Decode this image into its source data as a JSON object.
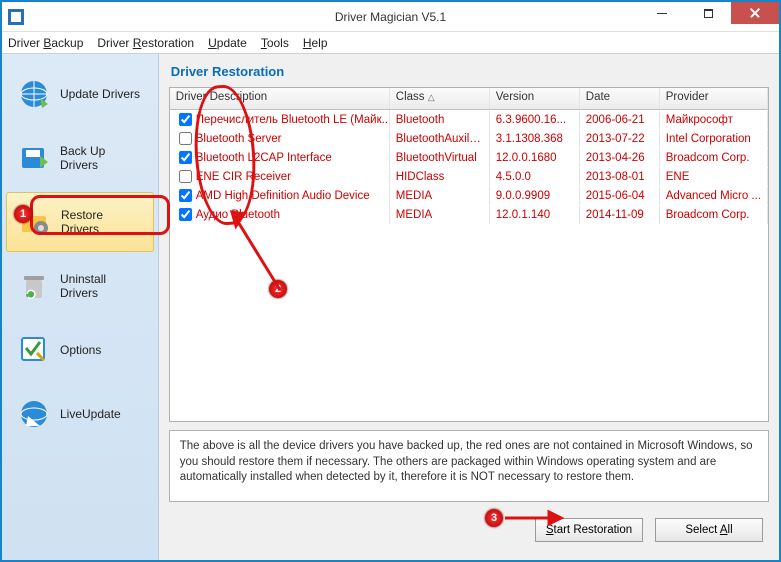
{
  "title": "Driver Magician V5.1",
  "menu": {
    "backup": "Driver Backup",
    "restoration": "Driver Restoration",
    "update": "Update",
    "tools": "Tools",
    "help": "Help"
  },
  "sidebar": {
    "items": [
      {
        "label": "Update Drivers"
      },
      {
        "label": "Back Up Drivers"
      },
      {
        "label": "Restore Drivers"
      },
      {
        "label": "Uninstall Drivers"
      },
      {
        "label": "Options"
      },
      {
        "label": "LiveUpdate"
      }
    ]
  },
  "panel": {
    "title": "Driver Restoration",
    "cols": {
      "desc": "Driver Description",
      "class": "Class",
      "version": "Version",
      "date": "Date",
      "provider": "Provider"
    },
    "rows": [
      {
        "checked": true,
        "red": true,
        "desc": "Перечислитель Bluetooth LE (Майк...",
        "class": "Bluetooth",
        "version": "6.3.9600.16...",
        "date": "2006-06-21",
        "provider": "Майкрософт"
      },
      {
        "checked": false,
        "red": true,
        "desc": "Bluetooth Server",
        "class": "BluetoothAuxiliary",
        "version": "3.1.1308.368",
        "date": "2013-07-22",
        "provider": "Intel Corporation"
      },
      {
        "checked": true,
        "red": true,
        "desc": "Bluetooth L2CAP Interface",
        "class": "BluetoothVirtual",
        "version": "12.0.0.1680",
        "date": "2013-04-26",
        "provider": "Broadcom Corp."
      },
      {
        "checked": false,
        "red": true,
        "desc": "ENE CIR Receiver",
        "class": "HIDClass",
        "version": "4.5.0.0",
        "date": "2013-08-01",
        "provider": "ENE"
      },
      {
        "checked": true,
        "red": true,
        "desc": "AMD High Definition Audio Device",
        "class": "MEDIA",
        "version": "9.0.0.9909",
        "date": "2015-06-04",
        "provider": "Advanced Micro ..."
      },
      {
        "checked": true,
        "red": true,
        "desc": "Аудио Bluetooth",
        "class": "MEDIA",
        "version": "12.0.1.140",
        "date": "2014-11-09",
        "provider": "Broadcom Corp."
      }
    ],
    "info": "The above is all the device drivers you have backed up, the red ones are not contained in Microsoft Windows, so you should restore them if necessary. The others are packaged within Windows operating system and are automatically installed when detected by it, therefore it is NOT necessary to restore them."
  },
  "footer": {
    "start": "Start Restoration",
    "select": "Select All"
  },
  "annotations": {
    "b1": "1",
    "b2": "2",
    "b3": "3"
  }
}
